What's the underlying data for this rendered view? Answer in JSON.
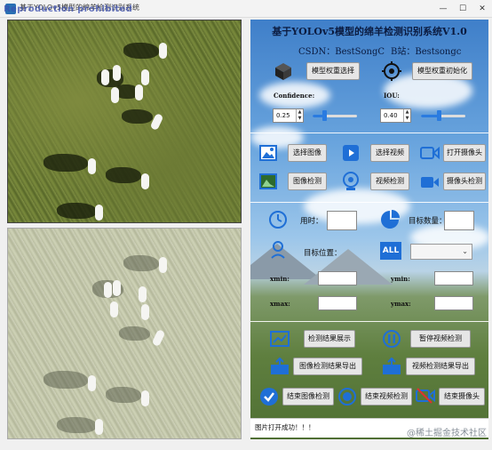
{
  "window": {
    "title": "基于YOLOv5模型的绵羊检测识别系统",
    "watermark": "Reproduction prohibited",
    "controls": [
      "—",
      "☐",
      "✕"
    ]
  },
  "header": {
    "title": "基于YOLOv5模型的绵羊检测识别系统V1.0",
    "csdn": "CSDN：BestSongC",
    "bilibili": "B站：Bestsongc"
  },
  "model": {
    "select_label": "模型权重选择",
    "init_label": "模型权重初始化"
  },
  "params": {
    "confidence_label": "Confidence:",
    "confidence_value": "0.25",
    "confidence_level": 0.25,
    "iou_label": "IOU:",
    "iou_value": "0.40",
    "iou_level": 0.4
  },
  "actions": {
    "select_image": "选择图像",
    "select_video": "选择视频",
    "open_camera": "打开摄像头",
    "image_detect": "图像检测",
    "video_detect": "视频检测",
    "camera_detect": "摄像头检测"
  },
  "results": {
    "time_label": "用时：",
    "count_label": "目标数量：",
    "position_label": "目标位置：",
    "all_icon": "ALL",
    "combo_arrow": "⌄",
    "xmin_label": "xmin:",
    "ymin_label": "ymin:",
    "xmax_label": "xmax:",
    "ymax_label": "ymax:"
  },
  "bottom": {
    "show_result": "检测结果展示",
    "pause_video": "暂停视频检测",
    "export_image": "图像检测结果导出",
    "export_video": "视频检测结果导出",
    "end_image": "结束图像检测",
    "end_video": "结束视频检测",
    "end_camera": "结束摄像头"
  },
  "status": {
    "message": "图片打开成功！！！"
  },
  "watermark_br": "@稀土掘金技术社区",
  "colors": {
    "accent": "#2a7be0",
    "icon_blue": "#1f6fd6"
  }
}
